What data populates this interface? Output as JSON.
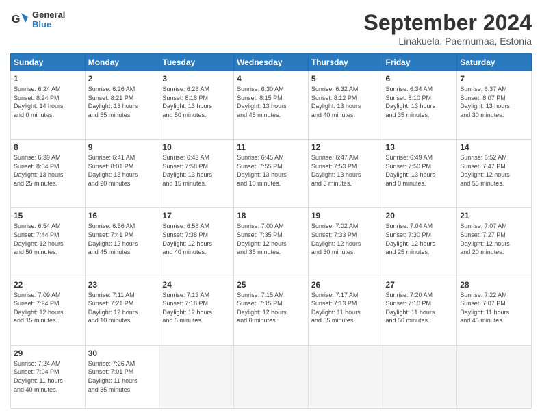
{
  "header": {
    "logo_line1": "General",
    "logo_line2": "Blue",
    "month": "September 2024",
    "location": "Linakuela, Paernumaa, Estonia"
  },
  "days_of_week": [
    "Sunday",
    "Monday",
    "Tuesday",
    "Wednesday",
    "Thursday",
    "Friday",
    "Saturday"
  ],
  "weeks": [
    [
      {
        "day": "1",
        "detail": "Sunrise: 6:24 AM\nSunset: 8:24 PM\nDaylight: 14 hours\nand 0 minutes."
      },
      {
        "day": "2",
        "detail": "Sunrise: 6:26 AM\nSunset: 8:21 PM\nDaylight: 13 hours\nand 55 minutes."
      },
      {
        "day": "3",
        "detail": "Sunrise: 6:28 AM\nSunset: 8:18 PM\nDaylight: 13 hours\nand 50 minutes."
      },
      {
        "day": "4",
        "detail": "Sunrise: 6:30 AM\nSunset: 8:15 PM\nDaylight: 13 hours\nand 45 minutes."
      },
      {
        "day": "5",
        "detail": "Sunrise: 6:32 AM\nSunset: 8:12 PM\nDaylight: 13 hours\nand 40 minutes."
      },
      {
        "day": "6",
        "detail": "Sunrise: 6:34 AM\nSunset: 8:10 PM\nDaylight: 13 hours\nand 35 minutes."
      },
      {
        "day": "7",
        "detail": "Sunrise: 6:37 AM\nSunset: 8:07 PM\nDaylight: 13 hours\nand 30 minutes."
      }
    ],
    [
      {
        "day": "8",
        "detail": "Sunrise: 6:39 AM\nSunset: 8:04 PM\nDaylight: 13 hours\nand 25 minutes."
      },
      {
        "day": "9",
        "detail": "Sunrise: 6:41 AM\nSunset: 8:01 PM\nDaylight: 13 hours\nand 20 minutes."
      },
      {
        "day": "10",
        "detail": "Sunrise: 6:43 AM\nSunset: 7:58 PM\nDaylight: 13 hours\nand 15 minutes."
      },
      {
        "day": "11",
        "detail": "Sunrise: 6:45 AM\nSunset: 7:55 PM\nDaylight: 13 hours\nand 10 minutes."
      },
      {
        "day": "12",
        "detail": "Sunrise: 6:47 AM\nSunset: 7:53 PM\nDaylight: 13 hours\nand 5 minutes."
      },
      {
        "day": "13",
        "detail": "Sunrise: 6:49 AM\nSunset: 7:50 PM\nDaylight: 13 hours\nand 0 minutes."
      },
      {
        "day": "14",
        "detail": "Sunrise: 6:52 AM\nSunset: 7:47 PM\nDaylight: 12 hours\nand 55 minutes."
      }
    ],
    [
      {
        "day": "15",
        "detail": "Sunrise: 6:54 AM\nSunset: 7:44 PM\nDaylight: 12 hours\nand 50 minutes."
      },
      {
        "day": "16",
        "detail": "Sunrise: 6:56 AM\nSunset: 7:41 PM\nDaylight: 12 hours\nand 45 minutes."
      },
      {
        "day": "17",
        "detail": "Sunrise: 6:58 AM\nSunset: 7:38 PM\nDaylight: 12 hours\nand 40 minutes."
      },
      {
        "day": "18",
        "detail": "Sunrise: 7:00 AM\nSunset: 7:35 PM\nDaylight: 12 hours\nand 35 minutes."
      },
      {
        "day": "19",
        "detail": "Sunrise: 7:02 AM\nSunset: 7:33 PM\nDaylight: 12 hours\nand 30 minutes."
      },
      {
        "day": "20",
        "detail": "Sunrise: 7:04 AM\nSunset: 7:30 PM\nDaylight: 12 hours\nand 25 minutes."
      },
      {
        "day": "21",
        "detail": "Sunrise: 7:07 AM\nSunset: 7:27 PM\nDaylight: 12 hours\nand 20 minutes."
      }
    ],
    [
      {
        "day": "22",
        "detail": "Sunrise: 7:09 AM\nSunset: 7:24 PM\nDaylight: 12 hours\nand 15 minutes."
      },
      {
        "day": "23",
        "detail": "Sunrise: 7:11 AM\nSunset: 7:21 PM\nDaylight: 12 hours\nand 10 minutes."
      },
      {
        "day": "24",
        "detail": "Sunrise: 7:13 AM\nSunset: 7:18 PM\nDaylight: 12 hours\nand 5 minutes."
      },
      {
        "day": "25",
        "detail": "Sunrise: 7:15 AM\nSunset: 7:15 PM\nDaylight: 12 hours\nand 0 minutes."
      },
      {
        "day": "26",
        "detail": "Sunrise: 7:17 AM\nSunset: 7:13 PM\nDaylight: 11 hours\nand 55 minutes."
      },
      {
        "day": "27",
        "detail": "Sunrise: 7:20 AM\nSunset: 7:10 PM\nDaylight: 11 hours\nand 50 minutes."
      },
      {
        "day": "28",
        "detail": "Sunrise: 7:22 AM\nSunset: 7:07 PM\nDaylight: 11 hours\nand 45 minutes."
      }
    ],
    [
      {
        "day": "29",
        "detail": "Sunrise: 7:24 AM\nSunset: 7:04 PM\nDaylight: 11 hours\nand 40 minutes."
      },
      {
        "day": "30",
        "detail": "Sunrise: 7:26 AM\nSunset: 7:01 PM\nDaylight: 11 hours\nand 35 minutes."
      },
      {
        "day": "",
        "detail": ""
      },
      {
        "day": "",
        "detail": ""
      },
      {
        "day": "",
        "detail": ""
      },
      {
        "day": "",
        "detail": ""
      },
      {
        "day": "",
        "detail": ""
      }
    ]
  ]
}
